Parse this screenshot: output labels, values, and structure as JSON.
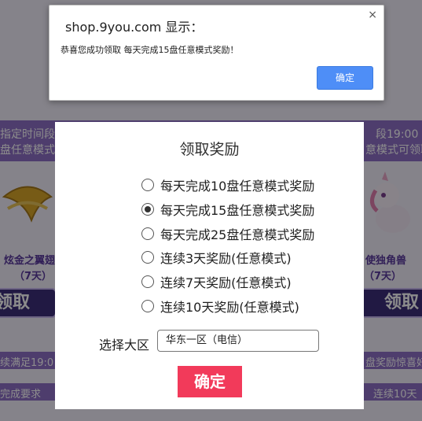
{
  "background": {
    "left_band_text_1": "指定时间段",
    "left_band_text_2": "盘任意模式可",
    "right_band_text_1": "段19:00",
    "right_band_text_2": "意模式可领取",
    "left_item_name": "炫金之翼翅",
    "left_item_days": "（7天）",
    "right_item_name": "使独角兽",
    "right_item_days": "（7天）",
    "claim_label": "领取",
    "left_footer_1": "续满足19:0",
    "left_footer_2": "完成要求",
    "right_footer_1": "盘奖励惊喜好礼",
    "right_footer_2": "连续10天"
  },
  "alert": {
    "title": "shop.9you.com 显示：",
    "message": "恭喜您成功领取 每天完成15盘任意模式奖励！",
    "ok_label": "确定",
    "close_icon": "×"
  },
  "modal": {
    "title": "领取奖励",
    "close_icon": "✕",
    "options": [
      {
        "label": "每天完成10盘任意模式奖励",
        "checked": false
      },
      {
        "label": "每天完成15盘任意模式奖励",
        "checked": true
      },
      {
        "label": "每天完成25盘任意模式奖励",
        "checked": false
      },
      {
        "label": "连续3天奖励(任意模式)",
        "checked": false
      },
      {
        "label": "连续7天奖励(任意模式)",
        "checked": false
      },
      {
        "label": "连续10天奖励(任意模式)",
        "checked": false
      }
    ],
    "region_label": "选择大区",
    "region_value": "华东一区（电信）",
    "confirm_label": "确定"
  }
}
